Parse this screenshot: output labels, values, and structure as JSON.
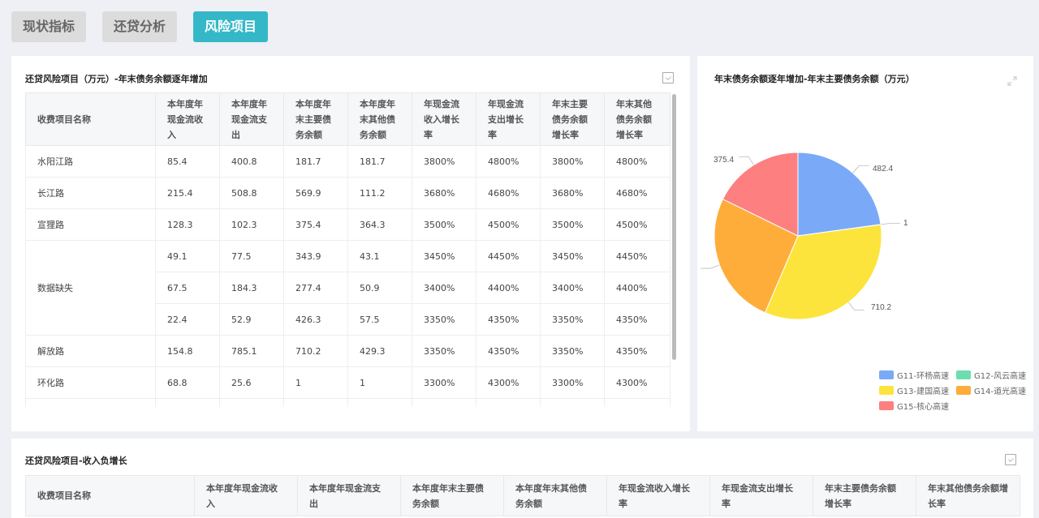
{
  "tabs": [
    {
      "label": "现状指标",
      "active": false
    },
    {
      "label": "还贷分析",
      "active": false
    },
    {
      "label": "风险项目",
      "active": true
    }
  ],
  "panel1": {
    "title": "还贷风险项目（万元）-年末债务余额逐年增加",
    "headers": [
      "收费项目名称",
      "本年度年现金流收入",
      "本年度年现金流支出",
      "本年度年末主要债务余额",
      "本年度年末其他债务余额",
      "年现金流收入增长率",
      "年现金流支出增长率",
      "年末主要债务余额增长率",
      "年末其他债务余额增长率"
    ],
    "rows": [
      {
        "name": "水阳江路",
        "values": [
          "85.4",
          "400.8",
          "181.7",
          "181.7",
          "3800%",
          "4800%",
          "3800%",
          "4800%"
        ]
      },
      {
        "name": "长江路",
        "values": [
          "215.4",
          "508.8",
          "569.9",
          "111.2",
          "3680%",
          "4680%",
          "3680%",
          "4680%"
        ]
      },
      {
        "name": "宣狸路",
        "values": [
          "128.3",
          "102.3",
          "375.4",
          "364.3",
          "3500%",
          "4500%",
          "3500%",
          "4500%"
        ]
      },
      {
        "name": "数据缺失",
        "values": [
          "49.1",
          "77.5",
          "343.9",
          "43.1",
          "3450%",
          "4450%",
          "3450%",
          "4450%"
        ]
      },
      {
        "name": "",
        "values": [
          "67.5",
          "184.3",
          "277.4",
          "50.9",
          "3400%",
          "4400%",
          "3400%",
          "4400%"
        ]
      },
      {
        "name": "",
        "values": [
          "22.4",
          "52.9",
          "426.3",
          "57.5",
          "3350%",
          "4350%",
          "3350%",
          "4350%"
        ]
      },
      {
        "name": "解放路",
        "values": [
          "154.8",
          "785.1",
          "710.2",
          "429.3",
          "3350%",
          "4350%",
          "3350%",
          "4350%"
        ]
      },
      {
        "name": "环化路",
        "values": [
          "68.8",
          "25.6",
          "1",
          "1",
          "3300%",
          "4300%",
          "3300%",
          "4300%"
        ]
      }
    ]
  },
  "panel2": {
    "title": "年末债务余额逐年增加-年末主要债务余额（万元）",
    "slice_labels": [
      "482.4",
      "1",
      "710.2",
      "375.4"
    ],
    "legend": [
      {
        "label": "G11-环杨高速",
        "color": "#7aaaf7"
      },
      {
        "label": "G12-风云高速",
        "color": "#6dddb0"
      },
      {
        "label": "G13-建国高速",
        "color": "#fde43c"
      },
      {
        "label": "G14-道光高速",
        "color": "#fead3b"
      },
      {
        "label": "G15-核心高速",
        "color": "#fd7f7f"
      }
    ]
  },
  "panel3": {
    "title": "还贷风险项目-收入负增长",
    "headers": [
      "收费项目名称",
      "本年度年现金流收入",
      "本年度年现金流支出",
      "本年度年末主要债务余额",
      "本年度年末其他债务余额",
      "年现金流收入增长率",
      "年现金流支出增长率",
      "年末主要债务余额增长率",
      "年末其他债务余额增长率"
    ]
  },
  "chart_data": {
    "type": "pie",
    "title": "年末债务余额逐年增加-年末主要债务余额（万元）",
    "categories": [
      "G11-环杨高速",
      "G12-风云高速",
      "G13-建国高速",
      "G14-道光高速",
      "G15-核心高速"
    ],
    "values": [
      482.4,
      1,
      710.2,
      546.5,
      375.4
    ],
    "colors": [
      "#7aaaf7",
      "#6dddb0",
      "#fde43c",
      "#fead3b",
      "#fd7f7f"
    ],
    "legend_position": "bottom-right"
  }
}
